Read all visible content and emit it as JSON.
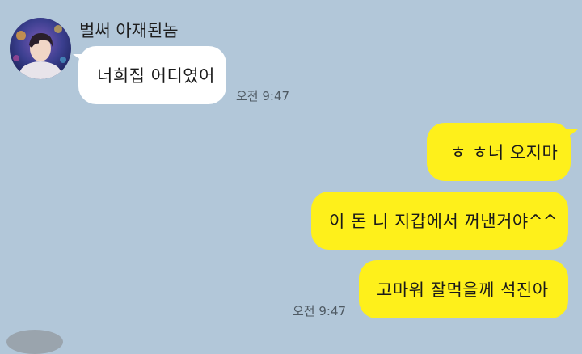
{
  "chat": {
    "sender_name": "벌써 아재된놈",
    "messages": [
      {
        "direction": "in",
        "text": "너희집 어디였어"
      },
      {
        "direction": "out",
        "text": "ㅎ ㅎ너 오지마"
      },
      {
        "direction": "out",
        "text": "이 돈 니 지갑에서 꺼낸거야^^"
      },
      {
        "direction": "out",
        "text": "고마워 잘먹을께 석진아"
      }
    ],
    "incoming_time": "오전 9:47",
    "outgoing_time": "오전 9:47"
  },
  "colors": {
    "background": "#b2c7d9",
    "incoming_bubble": "#ffffff",
    "outgoing_bubble": "#fef01b"
  },
  "icons": {
    "sender_avatar": "profile-photo-avatar"
  }
}
